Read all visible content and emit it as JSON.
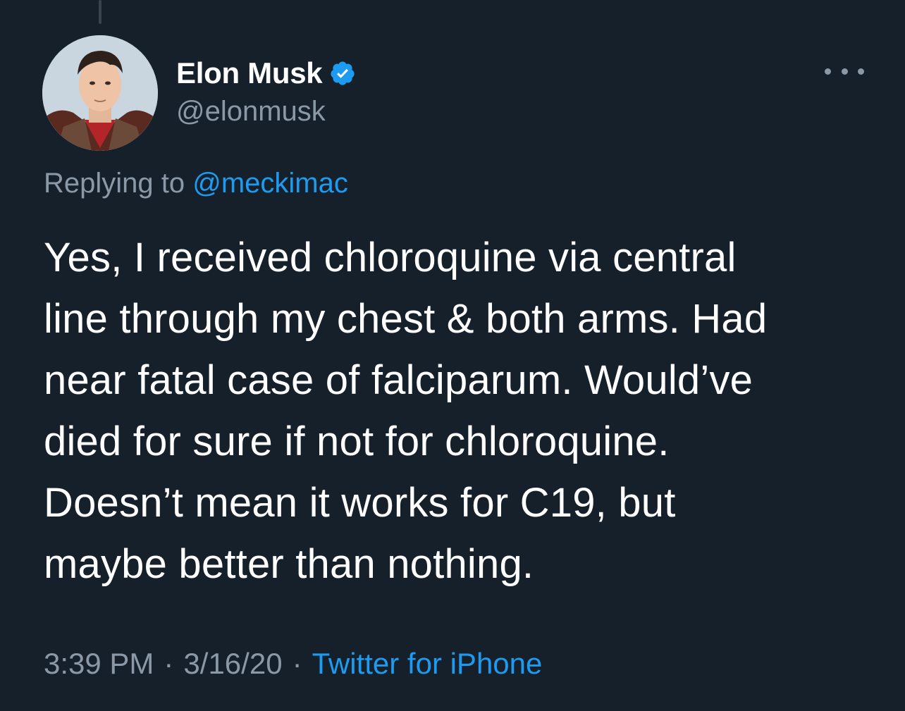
{
  "author": {
    "display_name": "Elon Musk",
    "handle": "@elonmusk",
    "verified": true,
    "avatar_icon": "profile-photo"
  },
  "reply": {
    "prefix": "Replying to",
    "mention": "@meckimac"
  },
  "tweet": {
    "lines": [
      "Yes, I received chloroquine via central",
      "line through my chest & both arms. Had",
      "near fatal case of falciparum. Would’ve",
      "died for sure if not for chloroquine.",
      "Doesn’t mean it works for C19, but",
      "maybe better than nothing."
    ]
  },
  "meta": {
    "time": "3:39 PM",
    "separator": "·",
    "date": "3/16/20",
    "source": "Twitter for iPhone"
  },
  "colors": {
    "background": "#15202b",
    "primary_text": "#ffffff",
    "secondary_text": "#8b98a5",
    "accent": "#1d9bf0"
  }
}
